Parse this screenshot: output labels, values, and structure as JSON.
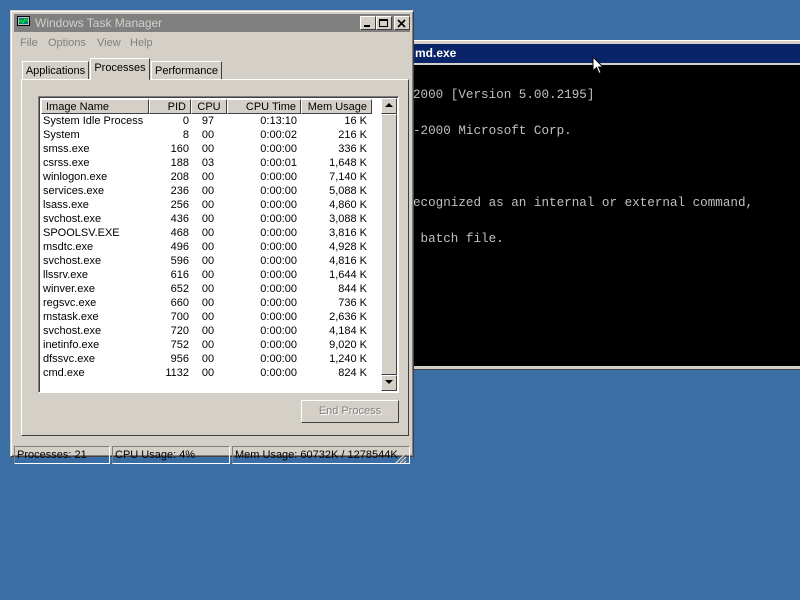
{
  "cmd": {
    "title": "md.exe",
    "lines": [
      "2000 [Version 5.00.2195]",
      "-2000 Microsoft Corp.",
      "",
      "ecognized as an internal or external command,",
      " batch file."
    ]
  },
  "taskmanager": {
    "title": "Windows Task Manager",
    "menu": [
      "File",
      "Options",
      "View",
      "Help"
    ],
    "tabs": [
      "Applications",
      "Processes",
      "Performance"
    ],
    "active_tab": "Processes",
    "columns": [
      "Image Name",
      "PID",
      "CPU",
      "CPU Time",
      "Mem Usage"
    ],
    "processes": [
      {
        "name": "System Idle Process",
        "pid": "0",
        "cpu": "97",
        "time": "0:13:10",
        "mem": "16 K"
      },
      {
        "name": "System",
        "pid": "8",
        "cpu": "00",
        "time": "0:00:02",
        "mem": "216 K"
      },
      {
        "name": "smss.exe",
        "pid": "160",
        "cpu": "00",
        "time": "0:00:00",
        "mem": "336 K"
      },
      {
        "name": "csrss.exe",
        "pid": "188",
        "cpu": "03",
        "time": "0:00:01",
        "mem": "1,648 K"
      },
      {
        "name": "winlogon.exe",
        "pid": "208",
        "cpu": "00",
        "time": "0:00:00",
        "mem": "7,140 K"
      },
      {
        "name": "services.exe",
        "pid": "236",
        "cpu": "00",
        "time": "0:00:00",
        "mem": "5,088 K"
      },
      {
        "name": "lsass.exe",
        "pid": "256",
        "cpu": "00",
        "time": "0:00:00",
        "mem": "4,860 K"
      },
      {
        "name": "svchost.exe",
        "pid": "436",
        "cpu": "00",
        "time": "0:00:00",
        "mem": "3,088 K"
      },
      {
        "name": "SPOOLSV.EXE",
        "pid": "468",
        "cpu": "00",
        "time": "0:00:00",
        "mem": "3,816 K"
      },
      {
        "name": "msdtc.exe",
        "pid": "496",
        "cpu": "00",
        "time": "0:00:00",
        "mem": "4,928 K"
      },
      {
        "name": "svchost.exe",
        "pid": "596",
        "cpu": "00",
        "time": "0:00:00",
        "mem": "4,816 K"
      },
      {
        "name": "llssrv.exe",
        "pid": "616",
        "cpu": "00",
        "time": "0:00:00",
        "mem": "1,644 K"
      },
      {
        "name": "winver.exe",
        "pid": "652",
        "cpu": "00",
        "time": "0:00:00",
        "mem": "844 K"
      },
      {
        "name": "regsvc.exe",
        "pid": "660",
        "cpu": "00",
        "time": "0:00:00",
        "mem": "736 K"
      },
      {
        "name": "mstask.exe",
        "pid": "700",
        "cpu": "00",
        "time": "0:00:00",
        "mem": "2,636 K"
      },
      {
        "name": "svchost.exe",
        "pid": "720",
        "cpu": "00",
        "time": "0:00:00",
        "mem": "4,184 K"
      },
      {
        "name": "inetinfo.exe",
        "pid": "752",
        "cpu": "00",
        "time": "0:00:00",
        "mem": "9,020 K"
      },
      {
        "name": "dfssvc.exe",
        "pid": "956",
        "cpu": "00",
        "time": "0:00:00",
        "mem": "1,240 K"
      },
      {
        "name": "cmd.exe",
        "pid": "1132",
        "cpu": "00",
        "time": "0:00:00",
        "mem": "824 K"
      }
    ],
    "end_process_label": "End Process",
    "status": {
      "processes": "Processes: 21",
      "cpu": "CPU Usage: 4%",
      "mem": "Mem Usage: 60732K / 1278544K"
    }
  },
  "colors": {
    "desktop": "#3a6ea5",
    "active_title": "#0a246a",
    "inactive_title": "#808080",
    "face": "#d4d0c8"
  }
}
